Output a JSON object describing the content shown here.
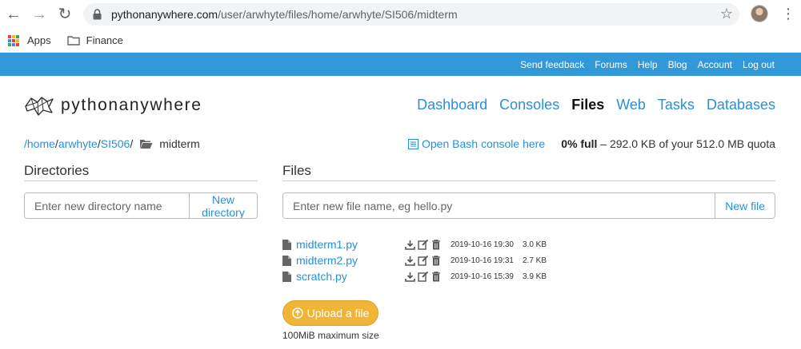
{
  "browser": {
    "url_host": "pythonanywhere.com",
    "url_path": "/user/arwhyte/files/home/arwhyte/SI506/midterm",
    "bookmarks": [
      {
        "label": "Apps",
        "icon": "apps-grid-icon"
      },
      {
        "label": "Finance",
        "icon": "folder-icon"
      }
    ]
  },
  "topbar": {
    "links": [
      "Send feedback",
      "Forums",
      "Help",
      "Blog",
      "Account",
      "Log out"
    ],
    "color": "#3299d8"
  },
  "header": {
    "logo_python": "python",
    "logo_anywhere": "anywhere",
    "nav": [
      {
        "label": "Dashboard",
        "active": false
      },
      {
        "label": "Consoles",
        "active": false
      },
      {
        "label": "Files",
        "active": true
      },
      {
        "label": "Web",
        "active": false
      },
      {
        "label": "Tasks",
        "active": false
      },
      {
        "label": "Databases",
        "active": false
      }
    ]
  },
  "path": {
    "segments": [
      "/",
      "home",
      "/",
      "arwhyte",
      "/",
      "SI506",
      "/"
    ],
    "current": "midterm",
    "bash_label": "Open Bash console here",
    "quota_percent": "0% full",
    "quota_rest": " – 292.0 KB of your 512.0 MB quota"
  },
  "directories": {
    "heading": "Directories",
    "placeholder": "Enter new directory name",
    "button": "New directory"
  },
  "files": {
    "heading": "Files",
    "placeholder": "Enter new file name, eg hello.py",
    "button": "New file",
    "items": [
      {
        "name": "midterm1.py",
        "date": "2019-10-16 19:30",
        "size": "3.0 KB"
      },
      {
        "name": "midterm2.py",
        "date": "2019-10-16 19:31",
        "size": "2.7 KB"
      },
      {
        "name": "scratch.py",
        "date": "2019-10-16 15:39",
        "size": "3.9 KB"
      }
    ],
    "upload_label": "Upload a file",
    "upload_note": "100MiB maximum size"
  },
  "colors": {
    "link": "#2a90d5",
    "upload": "#f0b437"
  }
}
